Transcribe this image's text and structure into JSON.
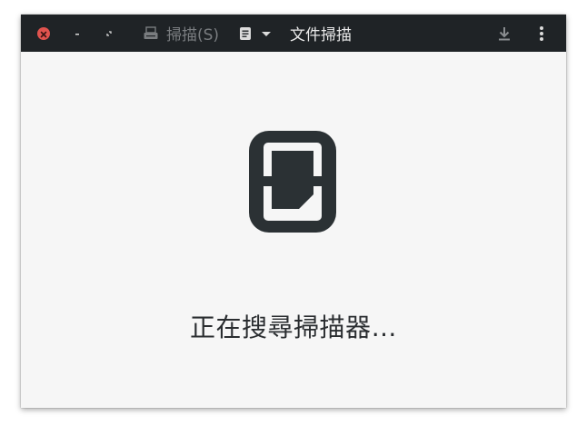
{
  "app": {
    "title": "文件掃描"
  },
  "titlebar": {
    "close_icon": "close-icon",
    "minimize_icon": "minimize-icon",
    "maximize_icon": "maximize-icon",
    "scan_label": "掃描(S)",
    "scan_icon": "scanner-icon",
    "doc_menu_icon": "document-icon",
    "download_icon": "download-icon",
    "menu_icon": "kebab-menu-icon"
  },
  "main": {
    "status_text": "正在搜尋掃描器…",
    "illustration_icon": "scanner-document-icon"
  },
  "colors": {
    "titlebar_bg": "#1f2326",
    "content_bg": "#f6f6f6",
    "close_red": "#e0534e",
    "icon_dark": "#2b3134"
  }
}
